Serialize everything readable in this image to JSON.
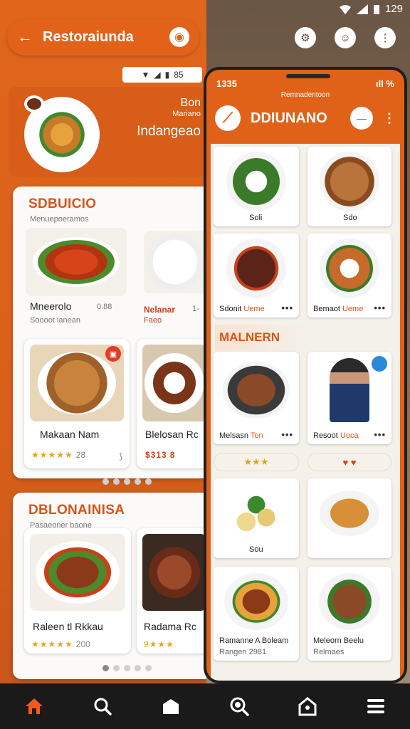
{
  "status_bar": {
    "time": "129",
    "icons": [
      "wifi-icon",
      "signal-icon",
      "battery-icon"
    ]
  },
  "left_app": {
    "title": "Restoraiunda",
    "mini_status": "85",
    "hero": {
      "line1": "Bon",
      "line2": "Mariano",
      "line3": "Indangeao"
    },
    "section1": {
      "title": "SDBUICIO",
      "subtitle": "Menuepoeramos",
      "cards": [
        {
          "name": "Mneerolo",
          "meta": "0.88",
          "sub": "Soooot ianean"
        },
        {
          "name": "Nelanar",
          "meta": "1-",
          "sub": "Faeo"
        },
        {
          "name": "Makaan Nam",
          "rating": "★★★★★",
          "count": "28"
        },
        {
          "name": "Blelosan Rc",
          "rating": "$313",
          "count": "8"
        }
      ]
    },
    "section2": {
      "title": "DBLONAINISA",
      "subtitle": "Pasaeoner baone",
      "cards": [
        {
          "name": "Raleen tl Rkkau",
          "rating": "★★★★★",
          "count": "200"
        },
        {
          "name": "Radama Rc",
          "rating": "9★★★",
          "count": ""
        }
      ]
    }
  },
  "phone": {
    "time": "1335",
    "status_right": "ıll %",
    "subtitle": "Remnadentoon",
    "title": "DDIUNANO",
    "pill_label": "—",
    "section_title": "MALNERN",
    "grid": [
      {
        "label": "Soli",
        "label2": "",
        "more": false
      },
      {
        "label": "Sdo",
        "label2": "",
        "more": false
      },
      {
        "label": "Sdonit",
        "label2": "Ueme",
        "more": true
      },
      {
        "label": "Bemaot",
        "label2": "Ueme",
        "more": true
      },
      {
        "label": "Melsasn",
        "label2": "Ton",
        "more": true
      },
      {
        "label": "Resoot",
        "label2": "Uoca",
        "more": true
      },
      {
        "label": "Sou",
        "label2": "",
        "more": false
      },
      {
        "label": "",
        "label2": "",
        "more": false
      },
      {
        "label": "Ramanne A Boleam",
        "label2": "Rangen 2981",
        "more": false
      },
      {
        "label": "Meleorn Beelu",
        "label2": "Relmaes",
        "more": false
      }
    ],
    "rating_pill_left": "★★★",
    "rating_pill_right": "♥ ♥"
  },
  "colors": {
    "accent": "#e06218",
    "title_orange": "#d8541a",
    "star": "#e8a416",
    "nav_bg": "#1a1a1a",
    "nav_active": "#f05a1e"
  },
  "bottom_nav": [
    {
      "icon": "home-icon",
      "active": true
    },
    {
      "icon": "search-icon",
      "active": false
    },
    {
      "icon": "store-icon",
      "active": false
    },
    {
      "icon": "zoom-search-icon",
      "active": false
    },
    {
      "icon": "profile-house-icon",
      "active": false
    },
    {
      "icon": "menu-icon",
      "active": false
    }
  ]
}
